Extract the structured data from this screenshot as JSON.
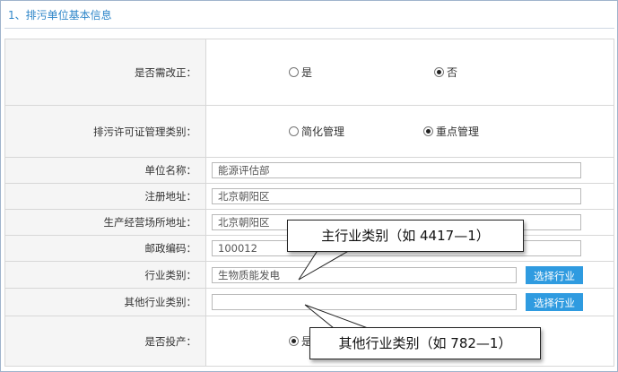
{
  "section": {
    "title": "1、排污单位基本信息"
  },
  "rows": {
    "rectify": {
      "label": "是否需改正：",
      "options": [
        {
          "label": "是",
          "checked": false
        },
        {
          "label": "否",
          "checked": true
        }
      ]
    },
    "permit_type": {
      "label": "排污许可证管理类别：",
      "options": [
        {
          "label": "简化管理",
          "checked": false
        },
        {
          "label": "重点管理",
          "checked": true
        }
      ]
    },
    "unit_name": {
      "label": "单位名称：",
      "value": "能源评估部"
    },
    "reg_address": {
      "label": "注册地址：",
      "value": "北京朝阳区"
    },
    "site_address": {
      "label": "生产经营场所地址：",
      "value": "北京朝阳区"
    },
    "postcode": {
      "label": "邮政编码：",
      "value": "100012"
    },
    "industry": {
      "label": "行业类别：",
      "value": "生物质能发电",
      "button": "选择行业"
    },
    "other_industry": {
      "label": "其他行业类别：",
      "value": "",
      "button": "选择行业"
    },
    "in_production": {
      "label": "是否投产：",
      "options": [
        {
          "label": "是",
          "checked": true
        }
      ]
    }
  },
  "callouts": {
    "main": "主行业类别（如 4417—1）",
    "other": "其他行业类别（如 782—1）"
  },
  "colors": {
    "accent": "#2e86c9",
    "button": "#2f9be0",
    "label_bg": "#f5f5f5",
    "border": "#d7d7d7"
  }
}
